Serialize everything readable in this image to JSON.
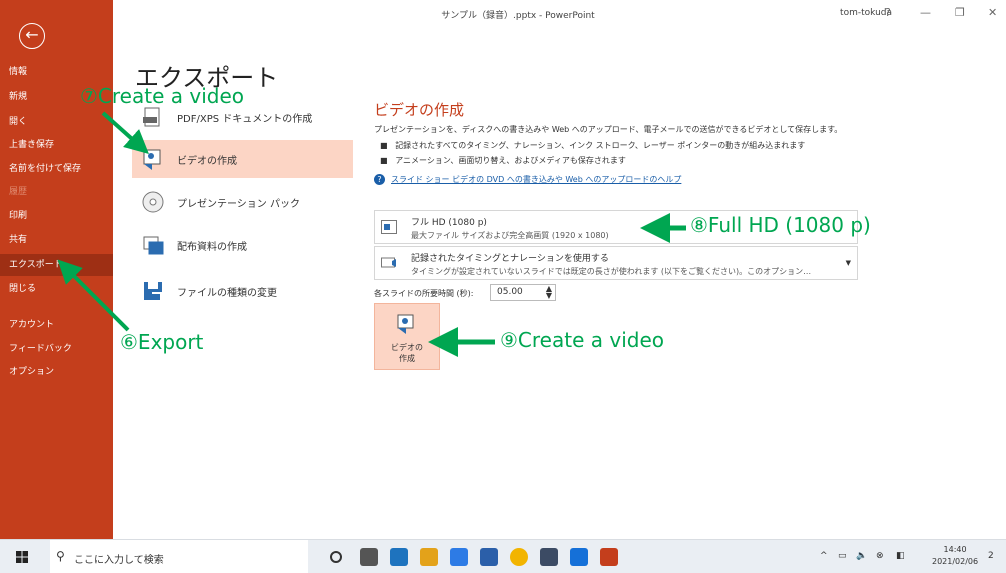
{
  "window": {
    "title": "サンプル（録音）.pptx  -  PowerPoint",
    "user": "tom-tokuda",
    "help": "?",
    "minimize": "—",
    "restore": "❐",
    "close": "✕"
  },
  "sidebar": {
    "back": "←",
    "items": [
      {
        "label": "情報"
      },
      {
        "label": "新規"
      },
      {
        "label": "開く"
      },
      {
        "label": "上書き保存"
      },
      {
        "label": "名前を付けて保存"
      },
      {
        "label": "履歴"
      },
      {
        "label": "印刷"
      },
      {
        "label": "共有"
      },
      {
        "label": "エクスポート"
      },
      {
        "label": "閉じる"
      },
      {
        "label": "アカウント"
      },
      {
        "label": "フィードバック"
      },
      {
        "label": "オプション"
      }
    ]
  },
  "export": {
    "heading": "エクスポート",
    "options": [
      {
        "label": "PDF/XPS ドキュメントの作成"
      },
      {
        "label": "ビデオの作成"
      },
      {
        "label": "プレゼンテーション パック"
      },
      {
        "label": "配布資料の作成"
      },
      {
        "label": "ファイルの種類の変更"
      }
    ]
  },
  "video_panel": {
    "title": "ビデオの作成",
    "description": "プレゼンテーションを、ディスクへの書き込みや Web へのアップロード、電子メールでの送信ができるビデオとして保存します。",
    "bullets": [
      "記録されたすべてのタイミング、ナレーション、インク ストローク、レーザー ポインターの動きが組み込まれます",
      "アニメーション、画面切り替え、およびメディアも保存されます"
    ],
    "help_link": "スライド ショー ビデオの DVD への書き込みや Web へのアップロードのヘルプ",
    "quality": {
      "label": "フル HD (1080 p)",
      "sub": "最大ファイル サイズおよび完全高画質 (1920 x 1080)"
    },
    "timing": {
      "label": "記録されたタイミングとナレーションを使用する",
      "sub": "タイミングが設定されていないスライドでは既定の長さが使われます (以下をご覧ください)。このオプション…"
    },
    "duration_label": "各スライドの所要時間 (秒):",
    "duration_value": "05.00",
    "create_button_line1": "ビデオの",
    "create_button_line2": "作成"
  },
  "annotations": {
    "step6": "⑥Export",
    "step7": "⑦Create a video",
    "step8": "⑧Full HD (1080 p)",
    "step9": "⑨Create a video",
    "color": "#00a651"
  },
  "taskbar": {
    "search_placeholder": "ここに入力して検索",
    "time": "14:40",
    "date": "2021/02/06",
    "notification_count": "2"
  }
}
